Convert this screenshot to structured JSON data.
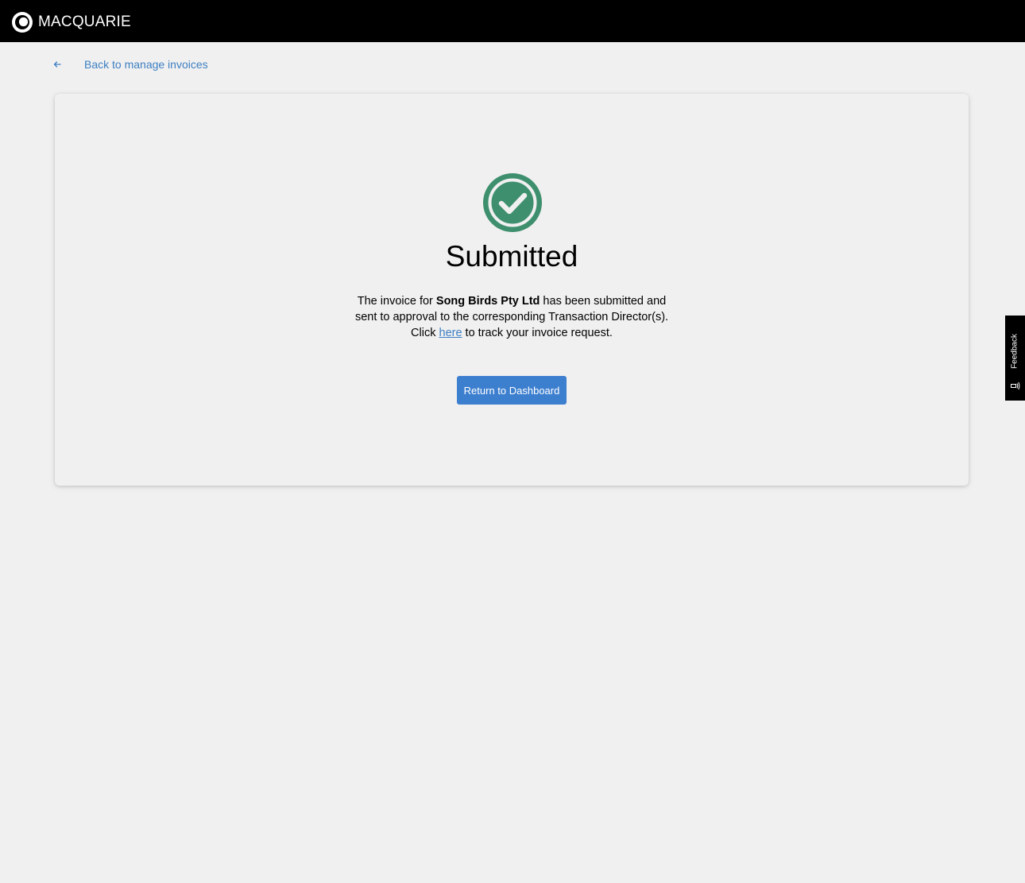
{
  "header": {
    "brand": "MACQUARIE",
    "logo_icon": "macquarie-logo-icon"
  },
  "nav": {
    "back_label": "Back to manage invoices",
    "back_icon": "arrow-left-icon"
  },
  "confirmation": {
    "icon": "check-circle-icon",
    "status_color": "#3e8f6e",
    "title": "Submitted",
    "message_part1": "The invoice for ",
    "company_name": "Song Birds Pty Ltd",
    "message_part2": " has been submitted and sent to approval to the corresponding Transaction Director(s). Click ",
    "link_label": "here",
    "message_part3": " to track your invoice request.",
    "button_label": "Return to Dashboard"
  },
  "feedback": {
    "label": "Feedback",
    "icon": "feedback-icon"
  },
  "colors": {
    "accent": "#3d7fcf",
    "link": "#3d7fc2",
    "header_bg": "#000000",
    "page_bg": "#f0f0f0"
  }
}
